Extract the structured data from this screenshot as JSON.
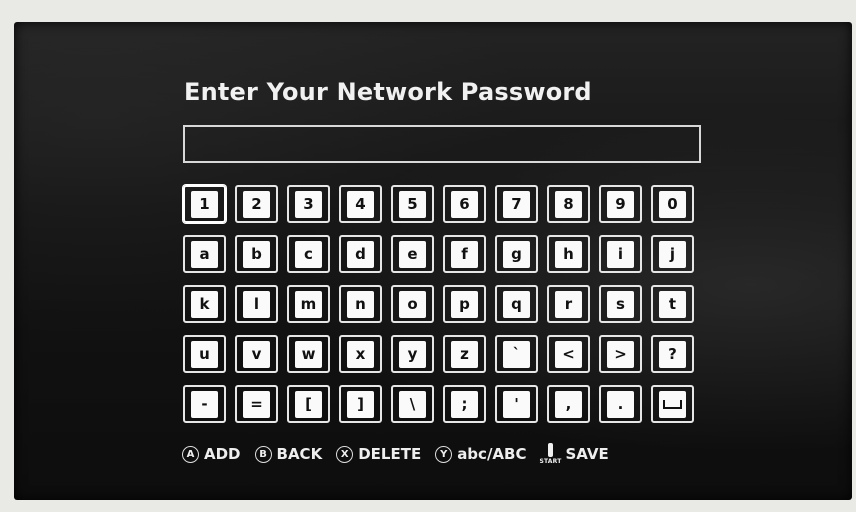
{
  "screen": {
    "title": "Enter Your Network Password",
    "password_value": ""
  },
  "keyboard": {
    "rows": [
      [
        "1",
        "2",
        "3",
        "4",
        "5",
        "6",
        "7",
        "8",
        "9",
        "0"
      ],
      [
        "a",
        "b",
        "c",
        "d",
        "e",
        "f",
        "g",
        "h",
        "i",
        "j"
      ],
      [
        "k",
        "l",
        "m",
        "n",
        "o",
        "p",
        "q",
        "r",
        "s",
        "t"
      ],
      [
        "u",
        "v",
        "w",
        "x",
        "y",
        "z",
        "`",
        "<",
        ">",
        "?"
      ],
      [
        "-",
        "=",
        "[",
        "]",
        "\\",
        ";",
        "'",
        ",",
        ".",
        "space"
      ]
    ],
    "selected_key": "1"
  },
  "legend": {
    "add": {
      "button": "A",
      "label": "ADD"
    },
    "back": {
      "button": "B",
      "label": "BACK"
    },
    "delete": {
      "button": "X",
      "label": "DELETE"
    },
    "case": {
      "button": "Y",
      "label": "abc/ABC"
    },
    "save": {
      "button": "START",
      "label": "SAVE"
    }
  }
}
